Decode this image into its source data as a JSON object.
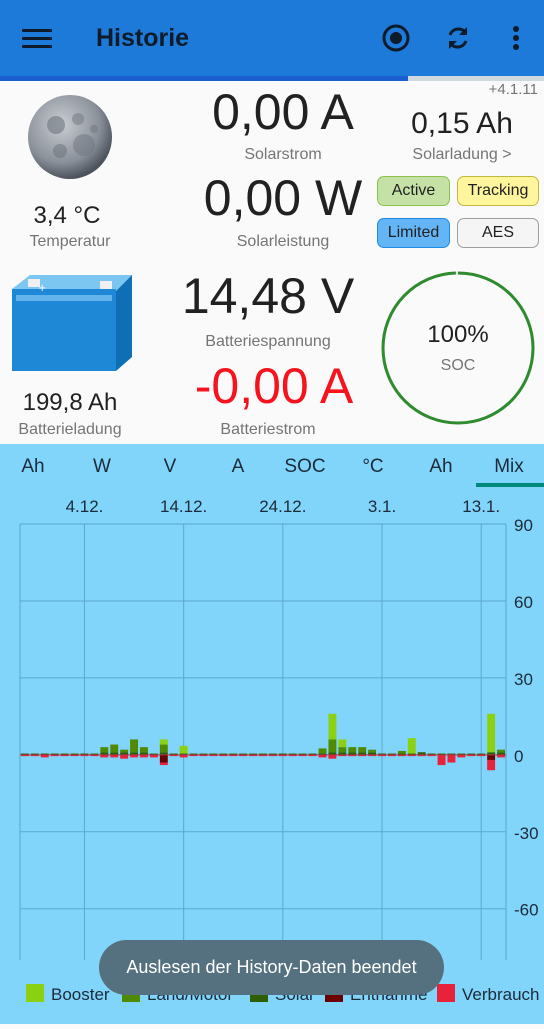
{
  "app": {
    "title": "Historie",
    "progress_fraction": 0.75
  },
  "panel": {
    "version": "+4.1.11",
    "temperature": {
      "value": "3,4 °C",
      "label": "Temperatur"
    },
    "solar_current": {
      "value": "0,00 A",
      "label": "Solarstrom"
    },
    "solar_charge": {
      "value": "0,15 Ah",
      "label": "Solarladung >"
    },
    "solar_power": {
      "value": "0,00 W",
      "label": "Solarleistung"
    },
    "battery_voltage": {
      "value": "14,48 V",
      "label": "Batteriespannung"
    },
    "battery_current": {
      "value": "-0,00 A",
      "label": "Batteriestrom"
    },
    "battery_charge": {
      "value": "199,8 Ah",
      "label": "Batterieladung"
    },
    "soc": {
      "value": "100%",
      "label": "SOC",
      "fraction": 0.995
    },
    "chips": [
      {
        "label": "Active",
        "bg": "#c5e1a5",
        "border": "#8bc34a"
      },
      {
        "label": "Tracking",
        "bg": "#fff59d",
        "border": "#c0b83c"
      },
      {
        "label": "Limited",
        "bg": "#64b5f6",
        "border": "#1e88e5"
      },
      {
        "label": "AES",
        "bg": "#f5f5f5",
        "border": "#9e9e9e"
      }
    ]
  },
  "tabs": [
    "Ah",
    "W",
    "V",
    "A",
    "SOC",
    "°C",
    "Ah",
    "Mix"
  ],
  "active_tab": "Mix",
  "toast": "Auslesen der History-Daten beendet",
  "colors": {
    "booster": "#8bd111",
    "land_motor": "#4f8a00",
    "solar": "#2f5e00",
    "entnahme": "#6a0000",
    "verbrauch": "#e8223a",
    "chart_bg": "#81d4fa"
  },
  "chart_data": {
    "type": "bar",
    "x_ticks": [
      "4.12.",
      "14.12.",
      "24.12.",
      "3.1.",
      "13.1."
    ],
    "y_ticks": [
      "90",
      "60",
      "30",
      "0",
      "-30",
      "-60"
    ],
    "ylim": [
      -80,
      90
    ],
    "legend": [
      "Booster",
      "Land/Motor",
      "Solar",
      "Entnahme",
      "Verbrauch"
    ],
    "legend_position": "bottom",
    "days": 49,
    "series": [
      {
        "name": "Booster",
        "values": [
          0,
          0,
          0,
          0,
          0,
          0,
          0,
          0,
          0,
          0,
          0,
          0,
          0,
          0,
          2,
          0,
          3,
          0,
          0,
          0,
          0,
          0,
          0,
          0,
          0,
          0,
          0,
          0,
          0,
          0,
          0,
          10,
          3,
          0,
          0,
          0,
          0,
          0,
          0,
          6,
          0,
          0,
          0,
          0,
          0,
          0,
          0,
          15,
          0
        ]
      },
      {
        "name": "Land/Motor",
        "values": [
          0,
          0,
          0,
          0,
          0,
          0,
          0,
          0,
          2,
          3,
          1,
          5,
          2,
          0,
          3,
          0,
          0,
          0,
          0,
          0,
          0,
          0,
          0,
          0,
          0,
          0,
          0,
          0,
          0,
          0,
          2,
          5,
          2,
          2,
          2,
          1,
          0,
          0,
          1,
          0,
          0,
          0,
          0,
          0,
          0,
          0,
          0,
          0,
          1
        ]
      },
      {
        "name": "Solar",
        "values": [
          0.5,
          0.5,
          0.5,
          0.5,
          0.5,
          0.5,
          0.5,
          0.5,
          1,
          1,
          1,
          1,
          1,
          0.5,
          1,
          0.5,
          0.5,
          0.5,
          0.5,
          0.5,
          0.5,
          0.5,
          0.5,
          0.5,
          0.5,
          0.5,
          0.5,
          0.5,
          0.5,
          0.5,
          0.5,
          1,
          1,
          1,
          1,
          1,
          0.5,
          0.5,
          0.5,
          0.5,
          1,
          0.5,
          0.5,
          0.5,
          0.5,
          0.5,
          0.5,
          1,
          1
        ]
      },
      {
        "name": "Entnahme",
        "values": [
          0,
          0,
          0,
          0,
          0,
          0,
          0,
          0,
          0,
          0,
          0,
          0,
          0,
          0,
          -3,
          0,
          0,
          0,
          0,
          0,
          0,
          0,
          0,
          0,
          0,
          0,
          0,
          0,
          0,
          0,
          0,
          0,
          0,
          0,
          0,
          0,
          0,
          0,
          0,
          0,
          0,
          0,
          0,
          0,
          0,
          0,
          0,
          -2,
          0
        ]
      },
      {
        "name": "Verbrauch",
        "values": [
          -0.5,
          -0.5,
          -1,
          -0.5,
          -0.5,
          -0.5,
          -0.5,
          -0.5,
          -1,
          -1,
          -1.5,
          -1,
          -1,
          -1,
          -1,
          -0.5,
          -1,
          -0.5,
          -0.5,
          -0.5,
          -0.5,
          -0.5,
          -0.5,
          -0.5,
          -0.5,
          -0.5,
          -0.5,
          -0.5,
          -0.5,
          -0.5,
          -1,
          -1.5,
          -0.5,
          -0.5,
          -0.5,
          -0.5,
          -0.5,
          -0.5,
          -0.5,
          -0.5,
          -0.5,
          -0.5,
          -4,
          -3,
          -1,
          -0.5,
          -0.5,
          -4,
          -1
        ]
      }
    ]
  }
}
